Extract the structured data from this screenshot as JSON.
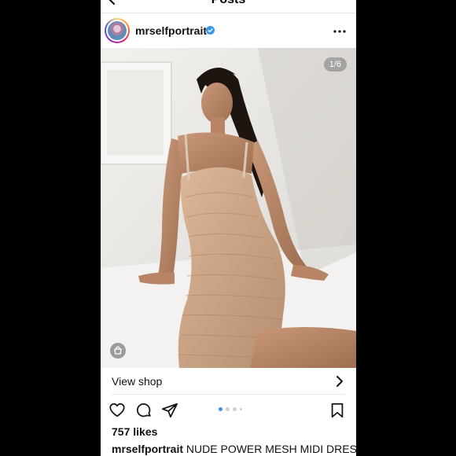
{
  "header": {
    "title": "Posts"
  },
  "post": {
    "username": "mrselfportrait",
    "verified": true,
    "image_counter": "1/6",
    "image_count": 6,
    "current_image": 1
  },
  "shop": {
    "label": "View shop"
  },
  "engagement": {
    "likes": "757 likes"
  },
  "caption": {
    "username": "mrselfportrait",
    "text": "NUDE POWER MESH MIDI DRESS"
  },
  "colors": {
    "verified": "#3897f0",
    "active_dot": "#3897f0"
  },
  "icons": [
    "back-arrow-icon",
    "verified-icon",
    "more-icon",
    "heart-icon",
    "comment-icon",
    "share-icon",
    "bookmark-icon",
    "shopping-bag-icon",
    "chevron-right-icon"
  ]
}
